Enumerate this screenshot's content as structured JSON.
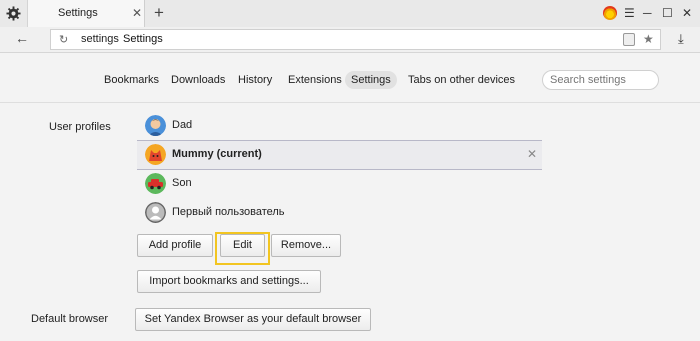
{
  "titlebar": {
    "tab_title": "Settings",
    "tab_close": "✕",
    "new_tab": "+",
    "minimize": "─",
    "maximize": "☐",
    "close": "✕",
    "menu": "☰"
  },
  "addressbar": {
    "back": "←",
    "reload": "↻",
    "url_host": "settings",
    "url_title": "Settings",
    "star": "★",
    "download": "⤓"
  },
  "nav": {
    "tabs": [
      "Bookmarks",
      "Downloads",
      "History",
      "Extensions",
      "Settings",
      "Tabs on other devices"
    ],
    "active": "Settings",
    "search_placeholder": "Search settings"
  },
  "user_profiles": {
    "label": "User profiles",
    "profiles": [
      {
        "name": "Dad",
        "avatar": "man-avatar-icon",
        "selected": false
      },
      {
        "name": "Mummy (current)",
        "avatar": "cat-avatar-icon",
        "selected": true
      },
      {
        "name": "Son",
        "avatar": "car-avatar-icon",
        "selected": false
      },
      {
        "name": "Первый пользователь",
        "avatar": "default-user-avatar-icon",
        "selected": false
      }
    ],
    "remove_icon": "✕",
    "buttons": {
      "add": "Add profile",
      "edit": "Edit",
      "remove": "Remove...",
      "import": "Import bookmarks and settings..."
    }
  },
  "default_browser": {
    "label": "Default browser",
    "button": "Set Yandex Browser as your default browser"
  },
  "colors": {
    "highlight": "#f2c521",
    "selected_row": "#ebebee"
  }
}
